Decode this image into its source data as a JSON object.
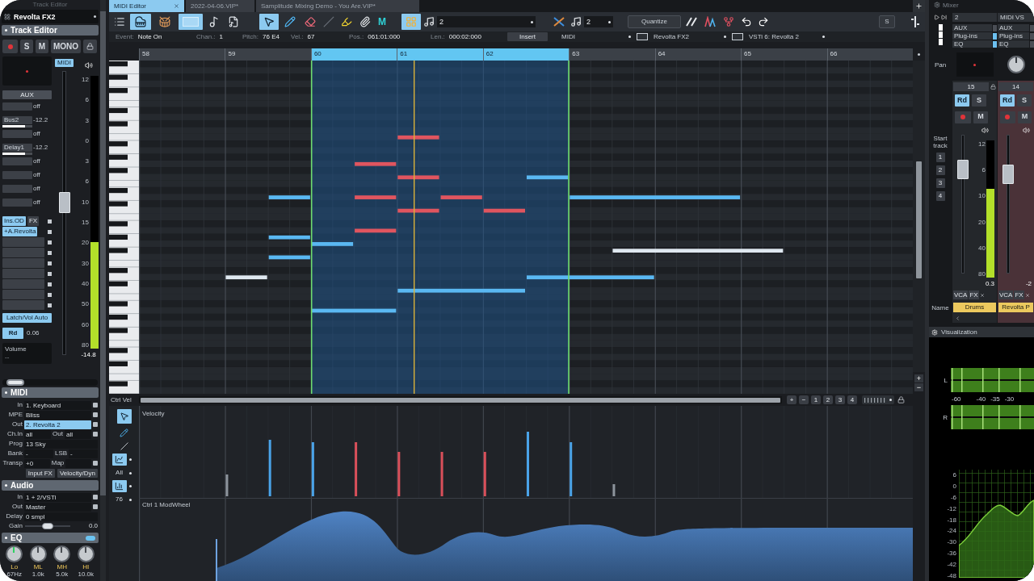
{
  "left_panel": {
    "top_title": "Track Editor",
    "track_name": "Revolta FX2",
    "section_title": "Track Editor",
    "buttons": [
      {
        "kind": "record",
        "on": false
      },
      {
        "kind": "text",
        "label": "S",
        "on": false
      },
      {
        "kind": "text",
        "label": "M",
        "on": false
      },
      {
        "kind": "text",
        "label": "MONO",
        "on": false
      },
      {
        "kind": "lock",
        "on": false
      }
    ],
    "input_badge": "MIDI",
    "aux_button": "AUX",
    "sends": [
      {
        "reading": "off"
      },
      {
        "name": "Bus2",
        "reading": "-12.2",
        "level": 0.75
      },
      {
        "reading": "off"
      },
      {
        "name": "Delay1",
        "reading": "-12.2",
        "level": 0.75
      },
      {
        "reading": "off"
      },
      {
        "reading": "off"
      },
      {
        "reading": "off"
      },
      {
        "reading": "off"
      }
    ],
    "fx_slots": [
      {
        "kind": "plugin",
        "label": "Ins.OD"
      },
      {
        "kind": "plugin",
        "label": "+A.Revolta"
      },
      {
        "kind": "empty"
      },
      {
        "kind": "empty"
      },
      {
        "kind": "empty"
      },
      {
        "kind": "empty"
      },
      {
        "kind": "empty"
      },
      {
        "kind": "empty"
      },
      {
        "kind": "empty"
      }
    ],
    "fx_button": "FX",
    "automation_button": {
      "label": "Latch/Vol Auto",
      "on": true
    },
    "read_button": {
      "label": "Rd",
      "on": true
    },
    "read_value": "0.06",
    "volume_label": "Volume",
    "volume_value": "--",
    "fader": {
      "level": 0.54,
      "reading": "-14.8",
      "scale": [
        "12",
        "6",
        "3",
        "0",
        "3",
        "6",
        "10",
        "15",
        "20",
        "30",
        "40",
        "50",
        "60",
        "80"
      ]
    },
    "meter": {
      "level": 0.39
    },
    "panel_slider": {
      "level": 0.05
    }
  },
  "midi_section": {
    "title": "MIDI",
    "rows": [
      {
        "kind": "fields",
        "label": "In",
        "dropdown": true,
        "fields": [
          {
            "text": "1. Keyboard",
            "active": false
          }
        ]
      },
      {
        "kind": "fields",
        "label": "MPE",
        "dropdown": true,
        "fields": [
          {
            "text": "Bliss",
            "active": false
          }
        ]
      },
      {
        "kind": "fields",
        "label": "Out",
        "dropdown": true,
        "fields": [
          {
            "text": "2. Revolta 2",
            "active": true
          }
        ]
      },
      {
        "kind": "fields",
        "label": "Ch.In",
        "dropdown": true,
        "fields": [
          {
            "text": "all",
            "active": false
          },
          {
            "label": "Out",
            "text": "all",
            "active": false
          }
        ]
      },
      {
        "kind": "fields",
        "label": "Prog",
        "dropdown": false,
        "fields": [
          {
            "text": "13 Sky",
            "active": false
          }
        ]
      },
      {
        "kind": "fields",
        "label": "Bank",
        "dropdown": false,
        "fields": [
          {
            "text": "-",
            "active": false
          },
          {
            "label": "LSB",
            "text": "-",
            "active": false
          }
        ]
      },
      {
        "kind": "fields",
        "label": "Transp",
        "dropdown": true,
        "fields": [
          {
            "text": "+0",
            "active": false
          },
          {
            "label": "Map",
            "active": false
          }
        ]
      }
    ],
    "buttons": [
      "Input FX",
      "Velocity/Dyn"
    ]
  },
  "audio_section": {
    "title": "Audio",
    "rows": [
      {
        "kind": "fields",
        "label": "In",
        "dropdown": true,
        "fields": [
          {
            "text": "1 + 2/VSTi",
            "active": false
          }
        ]
      },
      {
        "kind": "fields",
        "label": "Out",
        "dropdown": true,
        "fields": [
          {
            "text": "Master",
            "active": false
          }
        ]
      },
      {
        "kind": "fields",
        "label": "Delay",
        "dropdown": false,
        "fields": [
          {
            "text": "0 smpl",
            "active": false
          }
        ]
      },
      {
        "kind": "slider",
        "label": "Gain",
        "level": 0.5,
        "reading": "0.0"
      }
    ]
  },
  "eq_section": {
    "title": "EQ",
    "on": true,
    "bands": [
      {
        "label": "Lo",
        "value": "67Hz",
        "active": true
      },
      {
        "label": "ML",
        "value": "1.0k",
        "active": false
      },
      {
        "label": "MH",
        "value": "5.0k",
        "active": false
      },
      {
        "label": "HI",
        "value": "10.0k",
        "active": false
      }
    ]
  },
  "tabs": [
    {
      "label": "MIDI Editor",
      "selected": true
    },
    {
      "label": "2022-04-06.VIP*",
      "selected": false
    },
    {
      "label": "Samplitude Mixing Demo - You Are.VIP*",
      "selected": false
    }
  ],
  "toolbar": [
    [
      {
        "kind": "list",
        "selected": false
      },
      {
        "kind": "piano",
        "selected": true
      },
      {
        "kind": "drum",
        "selected": false
      },
      {
        "kind": "panel",
        "selected": true
      },
      {
        "kind": "clef",
        "selected": false
      },
      {
        "kind": "sheet",
        "selected": false
      }
    ],
    [
      {
        "kind": "pointer",
        "selected": true
      },
      {
        "kind": "pencil",
        "selected": false
      },
      {
        "kind": "eraser",
        "selected": false
      },
      {
        "kind": "knife",
        "selected": false
      },
      {
        "kind": "marker",
        "selected": false
      },
      {
        "kind": "glue",
        "selected": false
      },
      {
        "kind": "letter",
        "label": "M",
        "selected": false
      }
    ],
    [
      {
        "kind": "grid",
        "selected": true
      },
      {
        "kind": "note",
        "selected": false
      },
      {
        "kind": "field",
        "value": "2"
      }
    ],
    [
      {
        "kind": "crossfade",
        "selected": false
      },
      {
        "kind": "note",
        "selected": false
      },
      {
        "kind": "field",
        "value": "2"
      }
    ],
    [
      {
        "kind": "quantize",
        "label": "Quantize",
        "selected": false
      },
      {
        "kind": "lines",
        "selected": false
      },
      {
        "kind": "velocity",
        "selected": false
      },
      {
        "kind": "tree",
        "selected": false
      },
      {
        "kind": "undo",
        "selected": false
      },
      {
        "kind": "redo",
        "selected": false
      }
    ]
  ],
  "toolbar_right": [
    {
      "kind": "solo",
      "label": "S",
      "selected": false
    },
    {
      "kind": "split",
      "selected": false
    }
  ],
  "event_bar": {
    "fields": [
      {
        "label": "Event:",
        "value": "Note On"
      },
      {
        "label": "Chan.:",
        "value": "1"
      },
      {
        "label": "Pitch:",
        "value": "76 E4"
      },
      {
        "label": "Vel.:",
        "value": "67"
      },
      {
        "label": "Pos.:",
        "value": "061:01:000"
      },
      {
        "label": "Len.:",
        "value": "000:02:000"
      }
    ],
    "insert_button": "Insert",
    "dropdowns": [
      "MIDI",
      "Revolta FX2",
      "VSTi 6: Revolta 2"
    ]
  },
  "ruler": [
    {
      "label": "58",
      "selected": false
    },
    {
      "label": "59",
      "selected": false
    },
    {
      "label": "60",
      "selected": true
    },
    {
      "label": "61",
      "selected": true
    },
    {
      "label": "62",
      "selected": true
    },
    {
      "label": "63",
      "selected": false
    },
    {
      "label": "64",
      "selected": false
    },
    {
      "label": "65",
      "selected": false
    },
    {
      "label": "66",
      "selected": false
    }
  ],
  "vertical_zoom": [
    "+",
    "−"
  ],
  "lane_bar": {
    "label": "Ctrl Vel",
    "buttons": [
      "+",
      "−",
      "1",
      "2",
      "3",
      "4"
    ]
  },
  "lane_tools": [
    {
      "kind": "pointer",
      "selected": true
    },
    {
      "kind": "pencil",
      "selected": false
    },
    {
      "kind": "line",
      "selected": false
    },
    {
      "kind": "curve",
      "selected": true
    },
    {
      "kind": "dropdown",
      "label": "All",
      "selected": false
    },
    {
      "kind": "bars",
      "selected": true
    },
    {
      "kind": "dropdown",
      "label": "76",
      "selected": false
    }
  ],
  "velocity_lane": {
    "title": "Velocity"
  },
  "controller_lane": {
    "title": "Ctrl 1 ModWheel"
  },
  "mixer": {
    "title": "Mixer",
    "pan_label": "Pan",
    "start_track": {
      "label": "Start track",
      "buttons": [
        "1",
        "2",
        "3",
        "4"
      ]
    },
    "name_label": "Name",
    "channels": [
      {
        "selected": false,
        "input": "2",
        "routing": [
          {
            "label": "AUX",
            "on": false
          },
          {
            "label": "Plug-ins",
            "on": true
          },
          {
            "label": "EQ",
            "on": true
          }
        ],
        "pan": {
          "kind": "display"
        },
        "number": "15",
        "buttons": [
          {
            "kind": "text",
            "label": "Rd",
            "on": true
          },
          {
            "kind": "text",
            "label": "S",
            "on": false
          },
          {
            "kind": "record",
            "on": false
          },
          {
            "kind": "text",
            "label": "M",
            "on": false
          }
        ],
        "fader": {
          "level": 0.79
        },
        "meter": {
          "level": 0.65
        },
        "scale": [
          "12",
          "6",
          "10",
          "20",
          "40",
          "80"
        ],
        "reading": "0.3",
        "vca": "VCA",
        "fx": "FX",
        "name": "Drums"
      },
      {
        "selected": true,
        "input": "MIDI VS",
        "routing": [
          {
            "label": "AUX",
            "on": false
          },
          {
            "label": "Plug-ins",
            "on": false
          },
          {
            "label": "EQ",
            "on": false
          }
        ],
        "pan": {
          "kind": "knob"
        },
        "number": "14",
        "buttons": [
          {
            "kind": "text",
            "label": "Rd",
            "on": true
          },
          {
            "kind": "text",
            "label": "S",
            "on": false
          },
          {
            "kind": "record",
            "on": false
          },
          {
            "kind": "text",
            "label": "M",
            "on": false
          }
        ],
        "fader": {
          "level": 0.75
        },
        "reading": "-2",
        "vca": "VCA",
        "fx": "FX",
        "name": "Revolta P"
      }
    ]
  },
  "visualization": {
    "title": "Visualization",
    "channels": [
      "L",
      "R"
    ],
    "meter_scale": [
      "-60",
      "-40",
      "-35",
      "-30"
    ],
    "spectrum_scale": [
      "6",
      "0",
      "-6",
      "-12",
      "-18",
      "-24",
      "-30",
      "-36",
      "-42",
      "-48"
    ]
  }
}
